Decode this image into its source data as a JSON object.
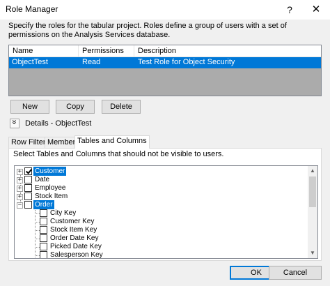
{
  "window": {
    "title": "Role Manager",
    "help_glyph": "?",
    "close_glyph": "✕"
  },
  "description": "Specify the roles for the tabular project. Roles define a group of users with a set of permissions on the Analysis Services database.",
  "roles_table": {
    "columns": [
      "Name",
      "Permissions",
      "Description"
    ],
    "rows": [
      {
        "name": "ObjectTest",
        "permissions": "Read",
        "description": "Test Role for Object Security",
        "selected": true
      }
    ]
  },
  "role_buttons": {
    "new": "New",
    "copy": "Copy",
    "delete": "Delete"
  },
  "details": {
    "toggle_glyph": "»",
    "label": "Details - ObjectTest"
  },
  "tabs": [
    {
      "label": "Row Filters",
      "active": false
    },
    {
      "label": "Members",
      "active": false
    },
    {
      "label": "Tables and Columns",
      "active": true
    }
  ],
  "tables_panel": {
    "hint": "Select Tables and Columns that should not be visible to users.",
    "tree": [
      {
        "label": "Customer",
        "level": 0,
        "expander": "+",
        "checked": true,
        "selected": true
      },
      {
        "label": "Date",
        "level": 0,
        "expander": "+",
        "checked": false,
        "selected": false
      },
      {
        "label": "Employee",
        "level": 0,
        "expander": "+",
        "checked": false,
        "selected": false
      },
      {
        "label": "Stock Item",
        "level": 0,
        "expander": "+",
        "checked": false,
        "selected": false
      },
      {
        "label": "Order",
        "level": 0,
        "expander": "−",
        "checked": false,
        "selected": true
      },
      {
        "label": "City Key",
        "level": 1,
        "checked": false,
        "selected": false
      },
      {
        "label": "Customer Key",
        "level": 1,
        "checked": false,
        "selected": false
      },
      {
        "label": "Stock Item Key",
        "level": 1,
        "checked": false,
        "selected": false
      },
      {
        "label": "Order Date Key",
        "level": 1,
        "checked": false,
        "selected": false
      },
      {
        "label": "Picked Date Key",
        "level": 1,
        "checked": false,
        "selected": false
      },
      {
        "label": "Salesperson Key",
        "level": 1,
        "checked": false,
        "selected": false
      }
    ],
    "scroll_up_glyph": "▲",
    "scroll_down_glyph": "▼"
  },
  "dialog_buttons": {
    "ok": "OK",
    "cancel": "Cancel"
  }
}
